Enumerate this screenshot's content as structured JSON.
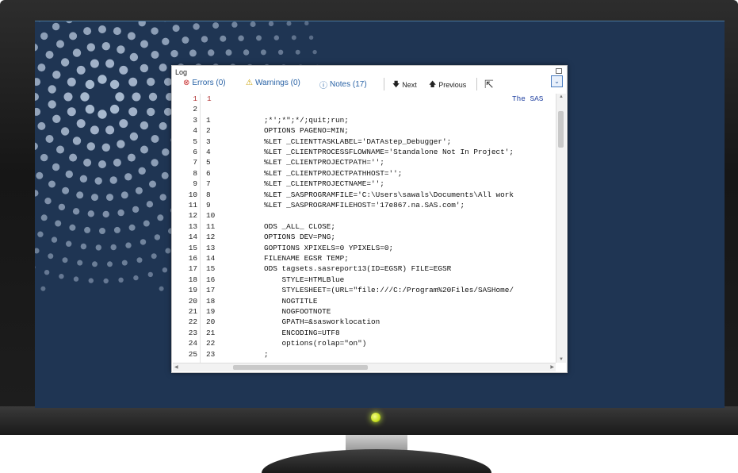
{
  "window": {
    "title": "Log"
  },
  "toolbar": {
    "errors_label": "Errors (0)",
    "warnings_label": "Warnings (0)",
    "notes_label": "Notes (17)",
    "next_label": "Next",
    "previous_label": "Previous"
  },
  "icons": {
    "errors": "error-circle-icon",
    "warnings": "warning-triangle-icon",
    "notes": "info-circle-icon",
    "next": "arrow-down-icon",
    "previous": "arrow-up-icon",
    "cursor": "mouse-pointer-icon",
    "dropdown": "chevron-down-icon",
    "restore": "restore-icon"
  },
  "colors": {
    "screen_bg": "#1f3553",
    "link_blue": "#2a63a6",
    "error_red": "#c93030",
    "warning_yellow": "#c9a000",
    "led_green": "#d6ff3a"
  },
  "log": {
    "lines": [
      {
        "ln1": "1",
        "ln2": "",
        "code": ""
      },
      {
        "ln1": "2",
        "ln2": "",
        "code": ""
      },
      {
        "ln1": "3",
        "ln2": "1",
        "code": ";*';*\";*/;quit;run;"
      },
      {
        "ln1": "4",
        "ln2": "2",
        "code": "OPTIONS PAGENO=MIN;"
      },
      {
        "ln1": "5",
        "ln2": "3",
        "code": "%LET _CLIENTTASKLABEL='DATAstep_Debugger';"
      },
      {
        "ln1": "6",
        "ln2": "4",
        "code": "%LET _CLIENTPROCESSFLOWNAME='Standalone Not In Project';"
      },
      {
        "ln1": "7",
        "ln2": "5",
        "code": "%LET _CLIENTPROJECTPATH='';"
      },
      {
        "ln1": "8",
        "ln2": "6",
        "code": "%LET _CLIENTPROJECTPATHHOST='';"
      },
      {
        "ln1": "9",
        "ln2": "7",
        "code": "%LET _CLIENTPROJECTNAME='';"
      },
      {
        "ln1": "10",
        "ln2": "8",
        "code": "%LET _SASPROGRAMFILE='C:\\Users\\sawals\\Documents\\All work"
      },
      {
        "ln1": "11",
        "ln2": "9",
        "code": "%LET _SASPROGRAMFILEHOST='17e867.na.SAS.com';"
      },
      {
        "ln1": "12",
        "ln2": "10",
        "code": ""
      },
      {
        "ln1": "13",
        "ln2": "11",
        "code": "ODS _ALL_ CLOSE;"
      },
      {
        "ln1": "14",
        "ln2": "12",
        "code": "OPTIONS DEV=PNG;"
      },
      {
        "ln1": "15",
        "ln2": "13",
        "code": "GOPTIONS XPIXELS=0 YPIXELS=0;"
      },
      {
        "ln1": "16",
        "ln2": "14",
        "code": "FILENAME EGSR TEMP;"
      },
      {
        "ln1": "17",
        "ln2": "15",
        "code": "ODS tagsets.sasreport13(ID=EGSR) FILE=EGSR"
      },
      {
        "ln1": "18",
        "ln2": "16",
        "code": "    STYLE=HTMLBlue"
      },
      {
        "ln1": "19",
        "ln2": "17",
        "code": "    STYLESHEET=(URL=\"file:///C:/Program%20Files/SASHome/"
      },
      {
        "ln1": "20",
        "ln2": "18",
        "code": "    NOGTITLE"
      },
      {
        "ln1": "21",
        "ln2": "19",
        "code": "    NOGFOOTNOTE"
      },
      {
        "ln1": "22",
        "ln2": "20",
        "code": "    GPATH=&sasworklocation"
      },
      {
        "ln1": "23",
        "ln2": "21",
        "code": "    ENCODING=UTF8"
      },
      {
        "ln1": "24",
        "ln2": "22",
        "code": "    options(rolap=\"on\")"
      },
      {
        "ln1": "25",
        "ln2": "23",
        "code": ";"
      }
    ],
    "first_line_marker": "1",
    "first_line_right_text": "The SAS"
  }
}
